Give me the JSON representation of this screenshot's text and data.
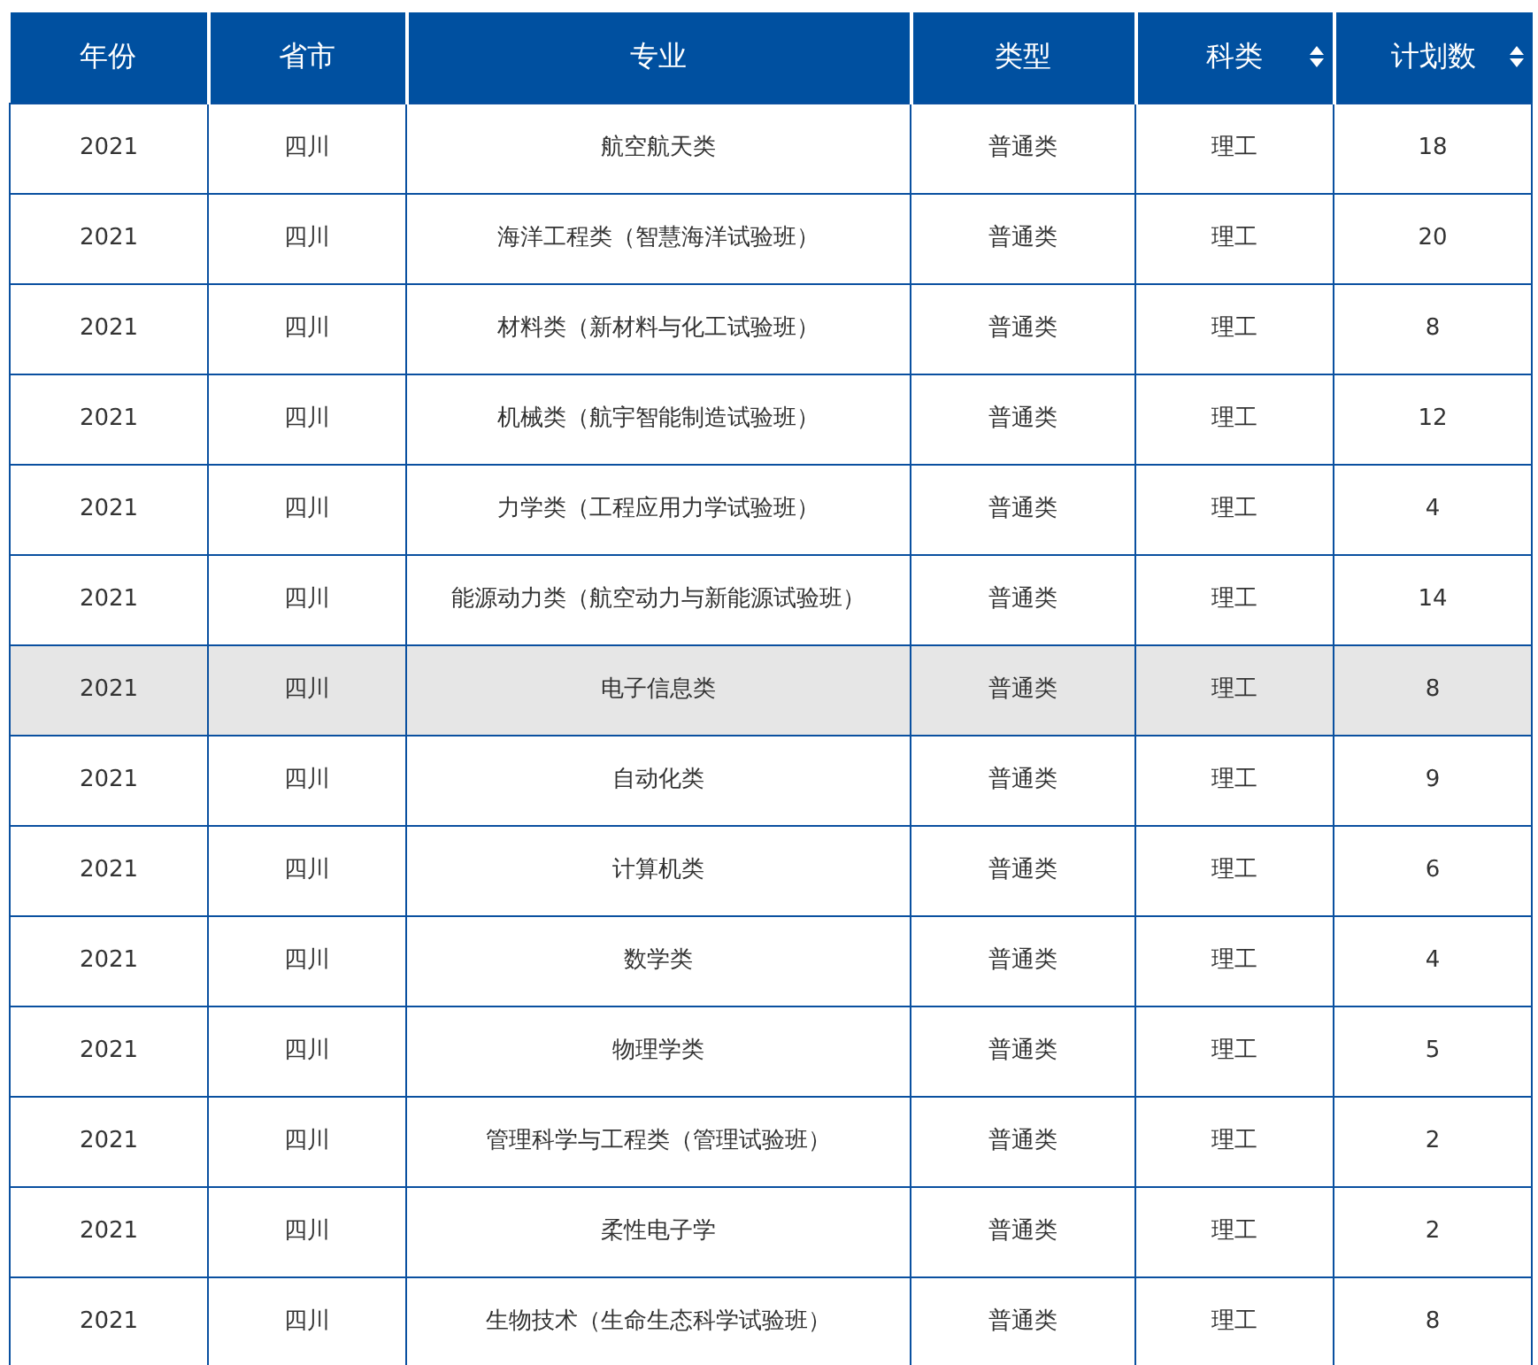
{
  "table": {
    "columns": [
      {
        "label": "年份",
        "sortable": false
      },
      {
        "label": "省市",
        "sortable": false
      },
      {
        "label": "专业",
        "sortable": false
      },
      {
        "label": "类型",
        "sortable": false
      },
      {
        "label": "科类",
        "sortable": true
      },
      {
        "label": "计划数",
        "sortable": true
      }
    ],
    "rows": [
      {
        "highlighted": false,
        "cells": [
          "2021",
          "四川",
          "航空航天类",
          "普通类",
          "理工",
          "18"
        ]
      },
      {
        "highlighted": false,
        "cells": [
          "2021",
          "四川",
          "海洋工程类（智慧海洋试验班）",
          "普通类",
          "理工",
          "20"
        ]
      },
      {
        "highlighted": false,
        "cells": [
          "2021",
          "四川",
          "材料类（新材料与化工试验班）",
          "普通类",
          "理工",
          "8"
        ]
      },
      {
        "highlighted": false,
        "cells": [
          "2021",
          "四川",
          "机械类（航宇智能制造试验班）",
          "普通类",
          "理工",
          "12"
        ]
      },
      {
        "highlighted": false,
        "cells": [
          "2021",
          "四川",
          "力学类（工程应用力学试验班）",
          "普通类",
          "理工",
          "4"
        ]
      },
      {
        "highlighted": false,
        "cells": [
          "2021",
          "四川",
          "能源动力类（航空动力与新能源试验班）",
          "普通类",
          "理工",
          "14"
        ]
      },
      {
        "highlighted": true,
        "cells": [
          "2021",
          "四川",
          "电子信息类",
          "普通类",
          "理工",
          "8"
        ]
      },
      {
        "highlighted": false,
        "cells": [
          "2021",
          "四川",
          "自动化类",
          "普通类",
          "理工",
          "9"
        ]
      },
      {
        "highlighted": false,
        "cells": [
          "2021",
          "四川",
          "计算机类",
          "普通类",
          "理工",
          "6"
        ]
      },
      {
        "highlighted": false,
        "cells": [
          "2021",
          "四川",
          "数学类",
          "普通类",
          "理工",
          "4"
        ]
      },
      {
        "highlighted": false,
        "cells": [
          "2021",
          "四川",
          "物理学类",
          "普通类",
          "理工",
          "5"
        ]
      },
      {
        "highlighted": false,
        "cells": [
          "2021",
          "四川",
          "管理科学与工程类（管理试验班）",
          "普通类",
          "理工",
          "2"
        ]
      },
      {
        "highlighted": false,
        "cells": [
          "2021",
          "四川",
          "柔性电子学",
          "普通类",
          "理工",
          "2"
        ]
      },
      {
        "highlighted": false,
        "cells": [
          "2021",
          "四川",
          "生物技术（生命生态科学试验班）",
          "普通类",
          "理工",
          "8"
        ]
      }
    ]
  }
}
